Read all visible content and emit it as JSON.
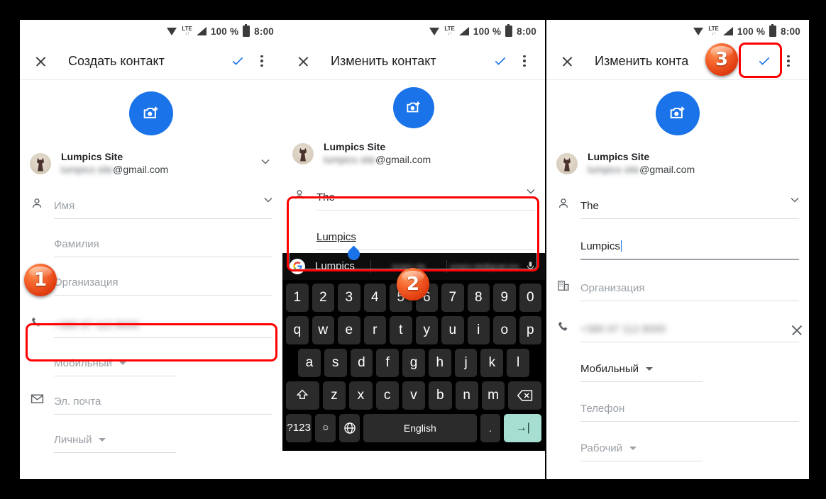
{
  "statusbar": {
    "network": "LTE",
    "updown": "↓↑",
    "battery": "100 %",
    "time": "8:00"
  },
  "panel1": {
    "title": "Создать контакт",
    "account": {
      "name": "Lumpics Site",
      "email_blurred": "lumpics site",
      "email_domain": "@gmail.com"
    },
    "fields": [
      {
        "label": "Имя",
        "value": ""
      },
      {
        "label": "Фамилия",
        "value": ""
      },
      {
        "label": "Организация",
        "value": ""
      },
      {
        "label": "phone",
        "value": "+380 97 112 8000"
      },
      {
        "label": "Мобильный",
        "value": ""
      },
      {
        "label": "Эл. почта",
        "value": ""
      },
      {
        "label": "Личный",
        "value": ""
      }
    ],
    "badge": "1"
  },
  "panel2": {
    "title": "Изменить контакт",
    "account": {
      "name": "Lumpics Site",
      "email_blurred": "lumpics site",
      "email_domain": "@gmail.com"
    },
    "first_name": "The",
    "last_name": "Lumpics",
    "badge": "2",
    "keyboard": {
      "suggestion_main": "Lumpics",
      "suggestion_2": "lumpics site",
      "suggestion_3_line1": "lumpics.site",
      "suggestion_3_line2": "@gmail.com",
      "row_numbers": [
        "1",
        "2",
        "3",
        "4",
        "5",
        "6",
        "7",
        "8",
        "9",
        "0"
      ],
      "row_top": [
        "q",
        "w",
        "e",
        "r",
        "t",
        "y",
        "u",
        "i",
        "o",
        "p"
      ],
      "row_home": [
        "a",
        "s",
        "d",
        "f",
        "g",
        "h",
        "j",
        "k",
        "l"
      ],
      "row_bottom": [
        "z",
        "x",
        "c",
        "v",
        "b",
        "n",
        "m"
      ],
      "shift": "shift-icon",
      "backspace": "backspace-icon",
      "symbols": "?123",
      "emoji": "☺",
      "comma": ",",
      "globe": "globe-icon",
      "space": "English",
      "period": ".",
      "enter": "→|"
    }
  },
  "panel3": {
    "title": "Изменить конта",
    "account": {
      "name": "Lumpics Site",
      "email_blurred": "lumpics site",
      "email_domain": "@gmail.com"
    },
    "first_name": "The",
    "last_name": "Lumpics",
    "organization_placeholder": "Организация",
    "phone_value_blurred": "+380 97 112 8000",
    "phone_type": "Мобильный",
    "phone_placeholder": "Телефон",
    "phone_type2": "Рабочий",
    "badge": "3"
  },
  "colors": {
    "accent": "#1a73e8",
    "annotation": "#ff0000",
    "enter_key": "#a6ded2"
  }
}
